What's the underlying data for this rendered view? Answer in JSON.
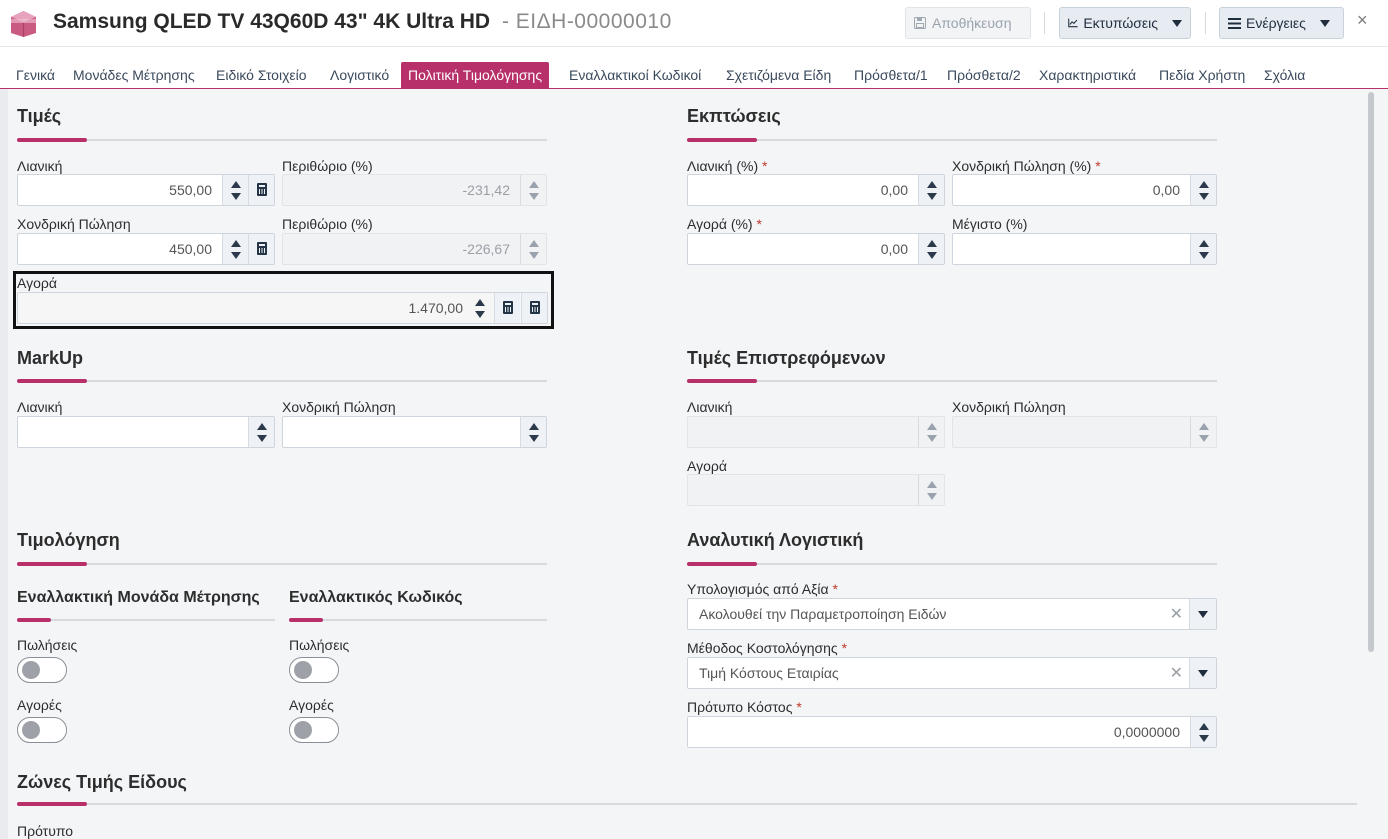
{
  "header": {
    "title": "Samsung QLED TV 43Q60D 43\" 4K Ultra HD",
    "separator": "-",
    "code": "ΕΙΔΗ-00000010",
    "save_label": "Αποθήκευση",
    "prints_label": "Εκτυπώσεις",
    "actions_label": "Ενέργειες",
    "close_label": "×"
  },
  "tabs": [
    {
      "label": "Γενικά"
    },
    {
      "label": "Μονάδες Μέτρησης"
    },
    {
      "label": "Ειδικό Στοιχείο"
    },
    {
      "label": "Λογιστικό"
    },
    {
      "label": "Πολιτική Τιμολόγησης"
    },
    {
      "label": "Εναλλακτικοί Κωδικοί"
    },
    {
      "label": "Σχετιζόμενα Είδη"
    },
    {
      "label": "Πρόσθετα/1"
    },
    {
      "label": "Πρόσθετα/2"
    },
    {
      "label": "Χαρακτηριστικά"
    },
    {
      "label": "Πεδία Χρήστη"
    },
    {
      "label": "Σχόλια"
    }
  ],
  "prices": {
    "title": "Τιμές",
    "retail_label": "Λιανική",
    "retail_value": "550,00",
    "retail_margin_label": "Περιθώριο (%)",
    "retail_margin_value": "-231,42",
    "wholesale_label": "Χονδρική Πώληση",
    "wholesale_value": "450,00",
    "wholesale_margin_label": "Περιθώριο (%)",
    "wholesale_margin_value": "-226,67",
    "purchase_label": "Αγορά",
    "purchase_value": "1.470,00"
  },
  "discounts": {
    "title": "Εκπτώσεις",
    "retail_label": "Λιανική (%)",
    "retail_value": "0,00",
    "wholesale_label": "Χονδρική Πώληση (%)",
    "wholesale_value": "0,00",
    "purchase_label": "Αγορά (%)",
    "purchase_value": "0,00",
    "max_label": "Μέγιστο (%)",
    "max_value": ""
  },
  "markup": {
    "title": "MarkUp",
    "retail_label": "Λιανική",
    "wholesale_label": "Χονδρική Πώληση"
  },
  "returns": {
    "title": "Τιμές Επιστρεφόμενων",
    "retail_label": "Λιανική",
    "wholesale_label": "Χονδρική Πώληση",
    "purchase_label": "Αγορά"
  },
  "invoicing": {
    "title": "Τιμολόγηση",
    "alt_unit_title": "Εναλλακτική Μονάδα Μέτρησης",
    "alt_code_title": "Εναλλακτικός Κωδικός",
    "sales_label": "Πωλήσεις",
    "purchases_label": "Αγορές"
  },
  "analytic": {
    "title": "Αναλυτική Λογιστική",
    "calc_label": "Υπολογισμός από Αξία",
    "calc_value": "Ακολουθεί την Παραμετροποίηση Ειδών",
    "costing_label": "Μέθοδος Κοστολόγησης",
    "costing_value": "Τιμή Κόστους Εταιρίας",
    "std_cost_label": "Πρότυπο Κόστος",
    "std_cost_value": "0,0000000"
  },
  "zones": {
    "title": "Ζώνες Τιμής Είδους",
    "template_label": "Πρότυπο"
  },
  "required_mark": "*"
}
